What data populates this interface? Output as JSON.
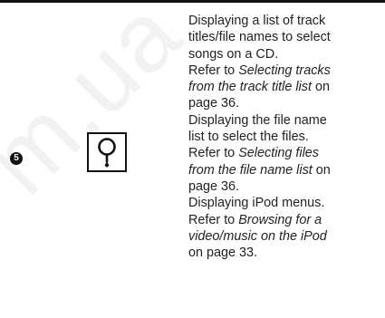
{
  "watermark": "m.ua",
  "row_number": "5",
  "icon": "magnifier-icon",
  "description": {
    "l1": "Displaying a list of track",
    "l2": "titles/file names to select",
    "l3": "songs on a CD.",
    "l4": "Refer to ",
    "l4_italic": "Selecting tracks",
    "l5_italic": "from the track title list",
    "l5": " on",
    "l6": "page 36.",
    "l7": "Displaying the file name",
    "l8": "list to select the files.",
    "l9": "Refer to ",
    "l9_italic": "Selecting files",
    "l10_italic": "from the file name list",
    "l10": " on",
    "l11": "page 36.",
    "l12": "Displaying iPod menus.",
    "l13": "Refer to ",
    "l13_italic": "Browsing for a",
    "l14_italic": "video/music on the iPod",
    "l15": "on page 33."
  }
}
